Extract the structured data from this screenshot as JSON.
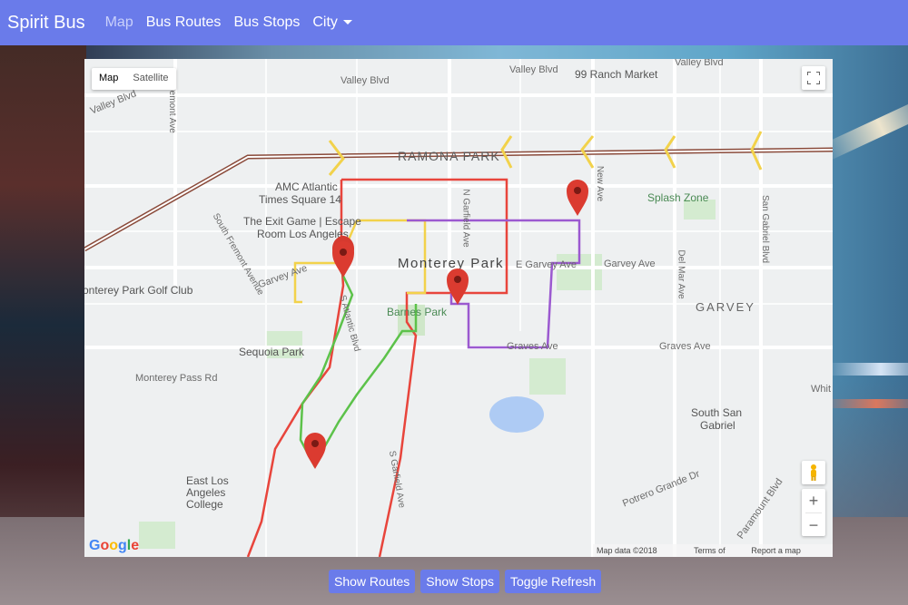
{
  "navbar": {
    "brand": "Spirit Bus",
    "links": [
      "Map",
      "Bus Routes",
      "Bus Stops",
      "City"
    ]
  },
  "map": {
    "map_type": [
      "Map",
      "Satellite"
    ],
    "labels": {
      "valley_blvd_left": "Valley Blvd",
      "valley_blvd_center": "Valley Blvd",
      "valley_blvd_right": "Valley Blvd",
      "ranch_market": "99 Ranch Market",
      "ramona_park": "RAMONA PARK",
      "amc": "AMC Atlantic",
      "amc2": "Times Square 14",
      "exit_game": "The Exit Game | Escape",
      "exit_game2": "Room Los Angeles",
      "splash_zone": "Splash Zone",
      "monterey_park": "Monterey Park",
      "golf_club": "onterey Park Golf Club",
      "garvey_left": "Garvey Ave",
      "garvey_mid": "E Garvey Ave",
      "garvey_right": "Garvey Ave",
      "garvey_city": "GARVEY",
      "barnes_park": "Barnes Park",
      "sequoia_park": "Sequoia Park",
      "monterey_pass": "Monterey Pass Rd",
      "graves_ave": "Graves Ave",
      "south_san_gabriel": "South San",
      "south_san_gabriel2": "Gabriel",
      "whit": "Whit",
      "ela_college": "East Los",
      "ela_college2": "Angeles",
      "ela_college3": "College",
      "potrero": "Potrero Grande Dr",
      "paramount": "Paramount Blvd",
      "fremont": "South Fremont Avenue",
      "garfield": "N Garfield Ave",
      "new_ave": "New Ave",
      "del_mar": "Del Mar Ave",
      "san_gabriel_blvd": "San Gabriel Blvd",
      "atlantic": "S Atlantic Blvd",
      "garfield_s": "S Garfield Ave",
      "fremont_top": "Fremont Ave",
      "pegman": "pegman-icon"
    },
    "google": [
      "G",
      "o",
      "o",
      "g",
      "l",
      "e"
    ],
    "google_colors": [
      "#4285f4",
      "#ea4335",
      "#fbbc05",
      "#4285f4",
      "#34a853",
      "#ea4335"
    ],
    "attribution": [
      "Map data ©2018 Google",
      "Terms of Use",
      "Report a map error"
    ],
    "zoom_in": "+",
    "zoom_out": "−",
    "route_colors": {
      "red": "#e8453c",
      "yellow": "#f2d24b",
      "purple": "#9b59d0",
      "green": "#5cc24a"
    }
  },
  "buttons": [
    "Show Routes",
    "Show Stops",
    "Toggle Refresh"
  ]
}
